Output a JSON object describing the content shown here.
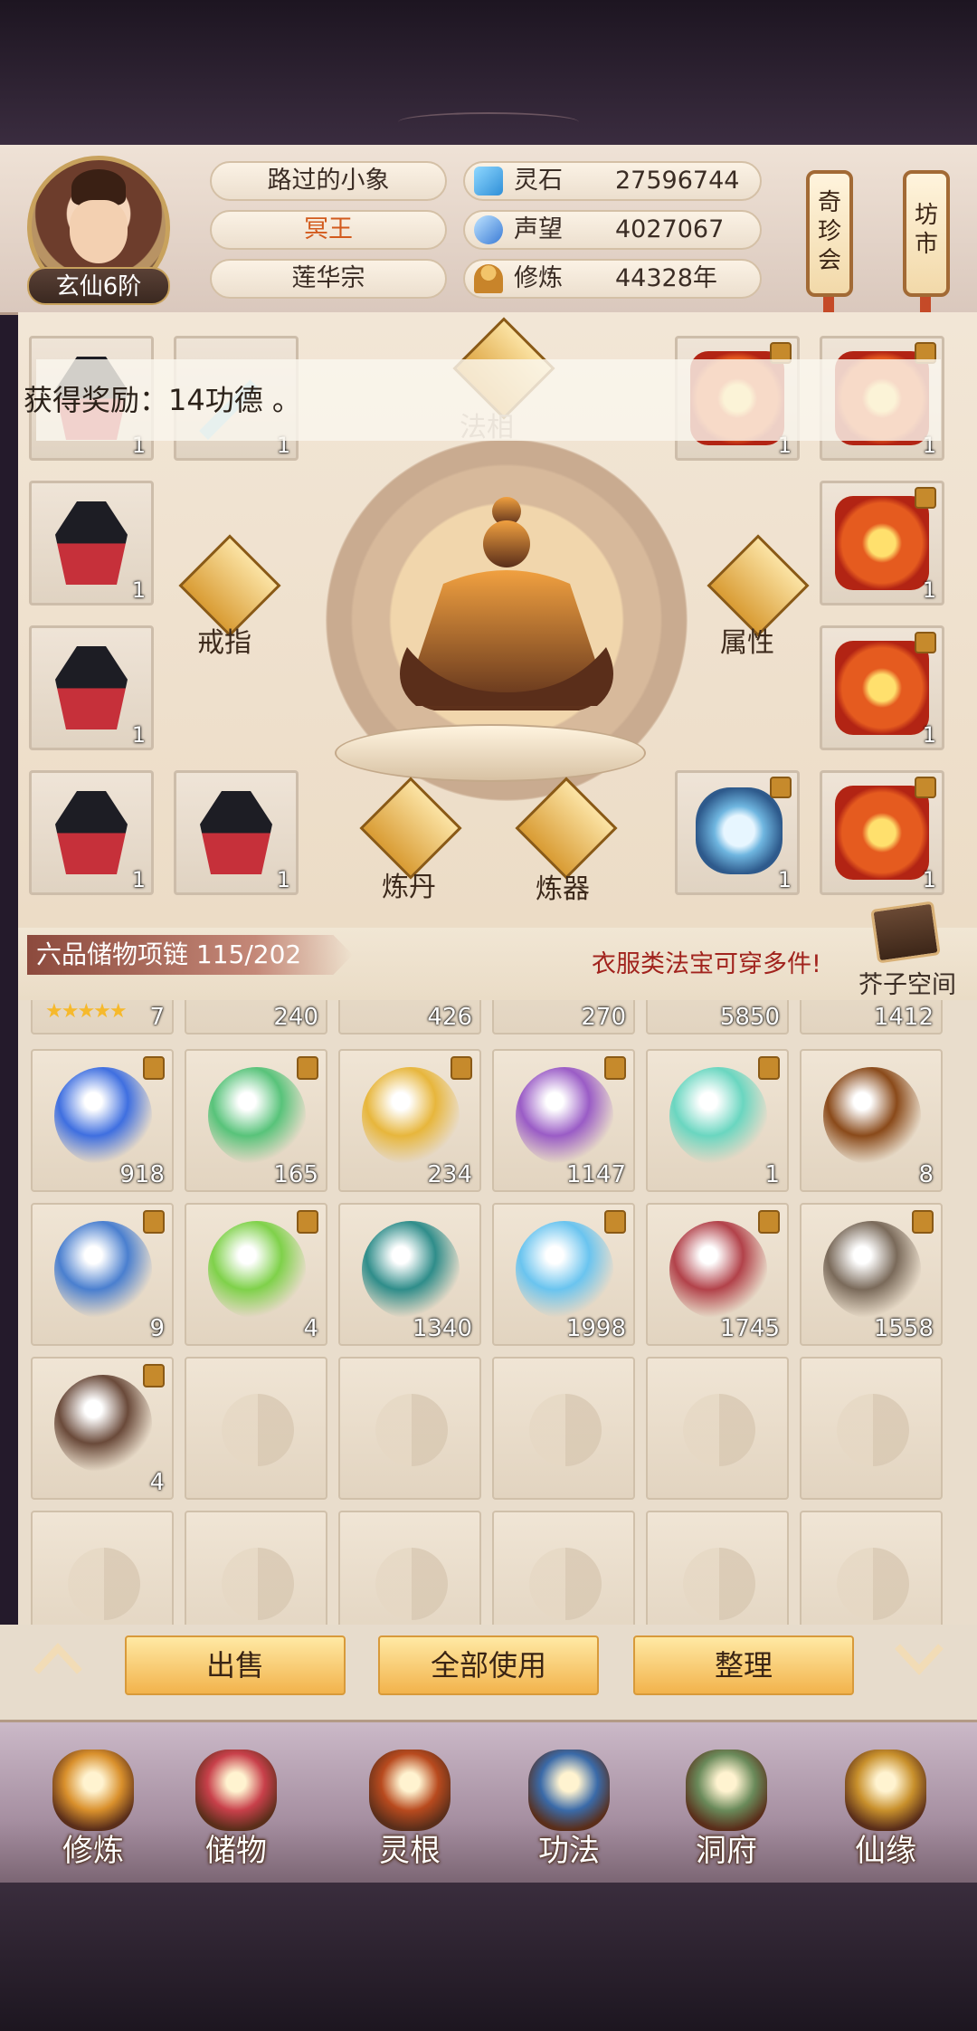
{
  "player": {
    "name": "路过的小象",
    "title": "冥王",
    "sect": "莲华宗",
    "rank": "玄仙6阶"
  },
  "stats": [
    {
      "label": "灵石",
      "value": "27596744",
      "icon": "spirit-stone-icon",
      "color": "#2f8fd8"
    },
    {
      "label": "声望",
      "value": "4027067",
      "icon": "reputation-icon",
      "color": "#3a7bd6"
    },
    {
      "label": "修炼",
      "value": "44328年",
      "icon": "meditation-icon",
      "color": "#d19a3a"
    }
  ],
  "side_banners": [
    {
      "label": "奇\n珍\n会"
    },
    {
      "label": "坊\n市"
    }
  ],
  "equipment": {
    "dharma_label": "法相",
    "ring_label": "戒指",
    "attribute_label": "属性",
    "alchemy_label": "炼丹",
    "forge_label": "炼器",
    "left_slots": [
      {
        "count": "1",
        "kind": "robe"
      },
      {
        "count": "1",
        "kind": "sword"
      },
      {
        "count": "1",
        "kind": "robe"
      },
      {
        "count": "1",
        "kind": "robe"
      },
      {
        "count": "1",
        "kind": "robe"
      },
      {
        "count": "1",
        "kind": "robe"
      }
    ],
    "right_slots": [
      {
        "count": "1",
        "kind": "cape"
      },
      {
        "count": "1",
        "kind": "cape"
      },
      {
        "count": "1",
        "kind": "cape"
      },
      {
        "count": "1",
        "kind": "cape"
      },
      {
        "count": "1",
        "kind": "ice"
      },
      {
        "count": "1",
        "kind": "cape"
      }
    ]
  },
  "toast": "获得奖励：14功德 。",
  "inventory": {
    "title": "六品储物项链 115/202",
    "note": "衣服类法宝可穿多件!",
    "space_label": "芥子空间",
    "partial_row": [
      {
        "count": "7",
        "stars": "★★★★★"
      },
      {
        "count": "240"
      },
      {
        "count": "426"
      },
      {
        "count": "270"
      },
      {
        "count": "5850"
      },
      {
        "count": "1412"
      }
    ],
    "rows": [
      [
        {
          "count": "918",
          "color": "#3f6fe0",
          "locked": true
        },
        {
          "count": "165",
          "color": "#58c37a",
          "locked": true
        },
        {
          "count": "234",
          "color": "#e7b63c",
          "locked": true
        },
        {
          "count": "1147",
          "color": "#9a5cc6",
          "locked": true
        },
        {
          "count": "1",
          "color": "#6ad6c0",
          "locked": true
        },
        {
          "count": "8",
          "color": "#8a4a1a",
          "locked": false
        }
      ],
      [
        {
          "count": "9",
          "color": "#4a7fcf",
          "locked": true
        },
        {
          "count": "4",
          "color": "#7fd14a",
          "locked": true
        },
        {
          "count": "1340",
          "color": "#2f8d8a",
          "locked": false
        },
        {
          "count": "1998",
          "color": "#6ac4ef",
          "locked": true
        },
        {
          "count": "1745",
          "color": "#b2424a",
          "locked": true
        },
        {
          "count": "1558",
          "color": "#7a6a5a",
          "locked": true
        }
      ],
      [
        {
          "count": "4",
          "color": "#6a4a3a",
          "locked": true
        },
        {
          "count": "",
          "color": "",
          "locked": false
        },
        {
          "count": "",
          "color": "",
          "locked": false
        },
        {
          "count": "",
          "color": "",
          "locked": false
        },
        {
          "count": "",
          "color": "",
          "locked": false
        },
        {
          "count": "",
          "color": "",
          "locked": false
        }
      ]
    ]
  },
  "actions": {
    "sell": "出售",
    "use_all": "全部使用",
    "sort": "整理"
  },
  "nav": [
    {
      "label": "修炼",
      "icon": "cultivation-icon",
      "color": "#d9902c"
    },
    {
      "label": "储物",
      "icon": "storage-bag-icon",
      "color": "#c8404a"
    },
    {
      "label": "灵根",
      "icon": "spirit-root-icon",
      "color": "#b84a1e"
    },
    {
      "label": "功法",
      "icon": "technique-book-icon",
      "color": "#3a6aa8"
    },
    {
      "label": "洞府",
      "icon": "cave-dwelling-icon",
      "color": "#6a8a5a"
    },
    {
      "label": "仙缘",
      "icon": "destiny-gourd-icon",
      "color": "#c8902c"
    }
  ]
}
